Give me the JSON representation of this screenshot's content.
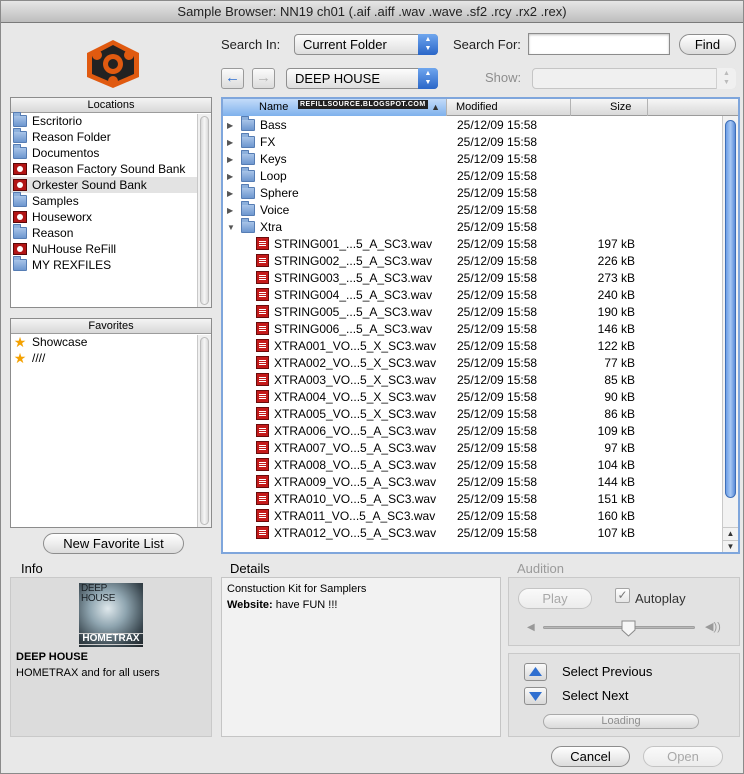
{
  "window": {
    "title": "Sample Browser: NN19 ch01 (.aif .aiff .wav .wave .sf2 .rcy .rx2 .rex)"
  },
  "toolbar": {
    "search_in_label": "Search In:",
    "search_in_value": "Current Folder",
    "search_for_label": "Search For:",
    "search_for_value": "",
    "find_label": "Find",
    "back_glyph": "←",
    "forward_glyph": "→",
    "path_value": "DEEP HOUSE",
    "show_label": "Show:",
    "show_value": ""
  },
  "locations": {
    "header": "Locations",
    "items": [
      {
        "label": "Escritorio",
        "icon": "folder-icon"
      },
      {
        "label": "Reason Folder",
        "icon": "folder-icon"
      },
      {
        "label": "Documentos",
        "icon": "folder-icon"
      },
      {
        "label": "Reason Factory Sound Bank",
        "icon": "reason-bank-icon"
      },
      {
        "label": "Orkester Sound Bank",
        "icon": "reason-bank-icon"
      },
      {
        "label": "Samples",
        "icon": "folder-icon"
      },
      {
        "label": "Houseworx",
        "icon": "reason-bank-icon"
      },
      {
        "label": "Reason",
        "icon": "folder-icon"
      },
      {
        "label": "NuHouse ReFill",
        "icon": "reason-bank-icon"
      },
      {
        "label": "MY REXFILES",
        "icon": "folder-icon"
      }
    ]
  },
  "favorites": {
    "header": "Favorites",
    "items": [
      {
        "label": "Showcase",
        "icon": "star-icon"
      },
      {
        "label": "////",
        "icon": "star-icon"
      }
    ]
  },
  "new_favorite_label": "New Favorite List",
  "browser": {
    "columns": {
      "name": "Name",
      "modified": "Modified",
      "size": "Size"
    },
    "watermark": "REFILLSOURCE.BLOGSPOT.COM",
    "sort_glyph": "▲",
    "folder_tri": "▶",
    "open_tri": "▼",
    "scroll_up": "▲",
    "scroll_down": "▼",
    "folders": [
      {
        "name": "Bass",
        "modified": "25/12/09 15:58"
      },
      {
        "name": "FX",
        "modified": "25/12/09 15:58"
      },
      {
        "name": "Keys",
        "modified": "25/12/09 15:58"
      },
      {
        "name": "Loop",
        "modified": "25/12/09 15:58"
      },
      {
        "name": "Sphere",
        "modified": "25/12/09 15:58"
      },
      {
        "name": "Voice",
        "modified": "25/12/09 15:58"
      }
    ],
    "open_folder": {
      "name": "Xtra",
      "modified": "25/12/09 15:58"
    },
    "files": [
      {
        "name": "STRING001_...5_A_SC3.wav",
        "modified": "25/12/09 15:58",
        "size": "197 kB"
      },
      {
        "name": "STRING002_...5_A_SC3.wav",
        "modified": "25/12/09 15:58",
        "size": "226 kB"
      },
      {
        "name": "STRING003_...5_A_SC3.wav",
        "modified": "25/12/09 15:58",
        "size": "273 kB"
      },
      {
        "name": "STRING004_...5_A_SC3.wav",
        "modified": "25/12/09 15:58",
        "size": "240 kB"
      },
      {
        "name": "STRING005_...5_A_SC3.wav",
        "modified": "25/12/09 15:58",
        "size": "190 kB"
      },
      {
        "name": "STRING006_...5_A_SC3.wav",
        "modified": "25/12/09 15:58",
        "size": "146 kB"
      },
      {
        "name": "XTRA001_VO...5_X_SC3.wav",
        "modified": "25/12/09 15:58",
        "size": "122 kB"
      },
      {
        "name": "XTRA002_VO...5_X_SC3.wav",
        "modified": "25/12/09 15:58",
        "size": "77 kB"
      },
      {
        "name": "XTRA003_VO...5_X_SC3.wav",
        "modified": "25/12/09 15:58",
        "size": "85 kB"
      },
      {
        "name": "XTRA004_VO...5_X_SC3.wav",
        "modified": "25/12/09 15:58",
        "size": "90 kB"
      },
      {
        "name": "XTRA005_VO...5_X_SC3.wav",
        "modified": "25/12/09 15:58",
        "size": "86 kB"
      },
      {
        "name": "XTRA006_VO...5_A_SC3.wav",
        "modified": "25/12/09 15:58",
        "size": "109 kB"
      },
      {
        "name": "XTRA007_VO...5_A_SC3.wav",
        "modified": "25/12/09 15:58",
        "size": "97 kB"
      },
      {
        "name": "XTRA008_VO...5_A_SC3.wav",
        "modified": "25/12/09 15:58",
        "size": "104 kB"
      },
      {
        "name": "XTRA009_VO...5_A_SC3.wav",
        "modified": "25/12/09 15:58",
        "size": "144 kB"
      },
      {
        "name": "XTRA010_VO...5_A_SC3.wav",
        "modified": "25/12/09 15:58",
        "size": "151 kB"
      },
      {
        "name": "XTRA011_VO...5_A_SC3.wav",
        "modified": "25/12/09 15:58",
        "size": "160 kB"
      },
      {
        "name": "XTRA012_VO...5_A_SC3.wav",
        "modified": "25/12/09 15:58",
        "size": "107 kB"
      }
    ]
  },
  "info": {
    "title": "Info",
    "art_line1": "DEEP",
    "art_line2": "HOUSE",
    "art_brand": "HOMETRAX",
    "name": "DEEP HOUSE",
    "subtitle": "HOMETRAX and for all users"
  },
  "details": {
    "title": "Details",
    "description": "Constuction Kit for Samplers",
    "website_label": "Website:",
    "website_value": "have FUN !!!"
  },
  "audition": {
    "title": "Audition",
    "play_label": "Play",
    "autoplay_label": "Autoplay",
    "autoplay_checked": true,
    "check_glyph": "✓",
    "volume_level": 0.56
  },
  "selection": {
    "previous_label": "Select Previous",
    "next_label": "Select Next",
    "loading_label": "Loading"
  },
  "footer": {
    "cancel_label": "Cancel",
    "open_label": "Open"
  },
  "colors": {
    "accent": "#3a78d8",
    "selection_border": "#7fa6dc",
    "wav_icon": "#c41a1a",
    "star": "#f4a100"
  }
}
